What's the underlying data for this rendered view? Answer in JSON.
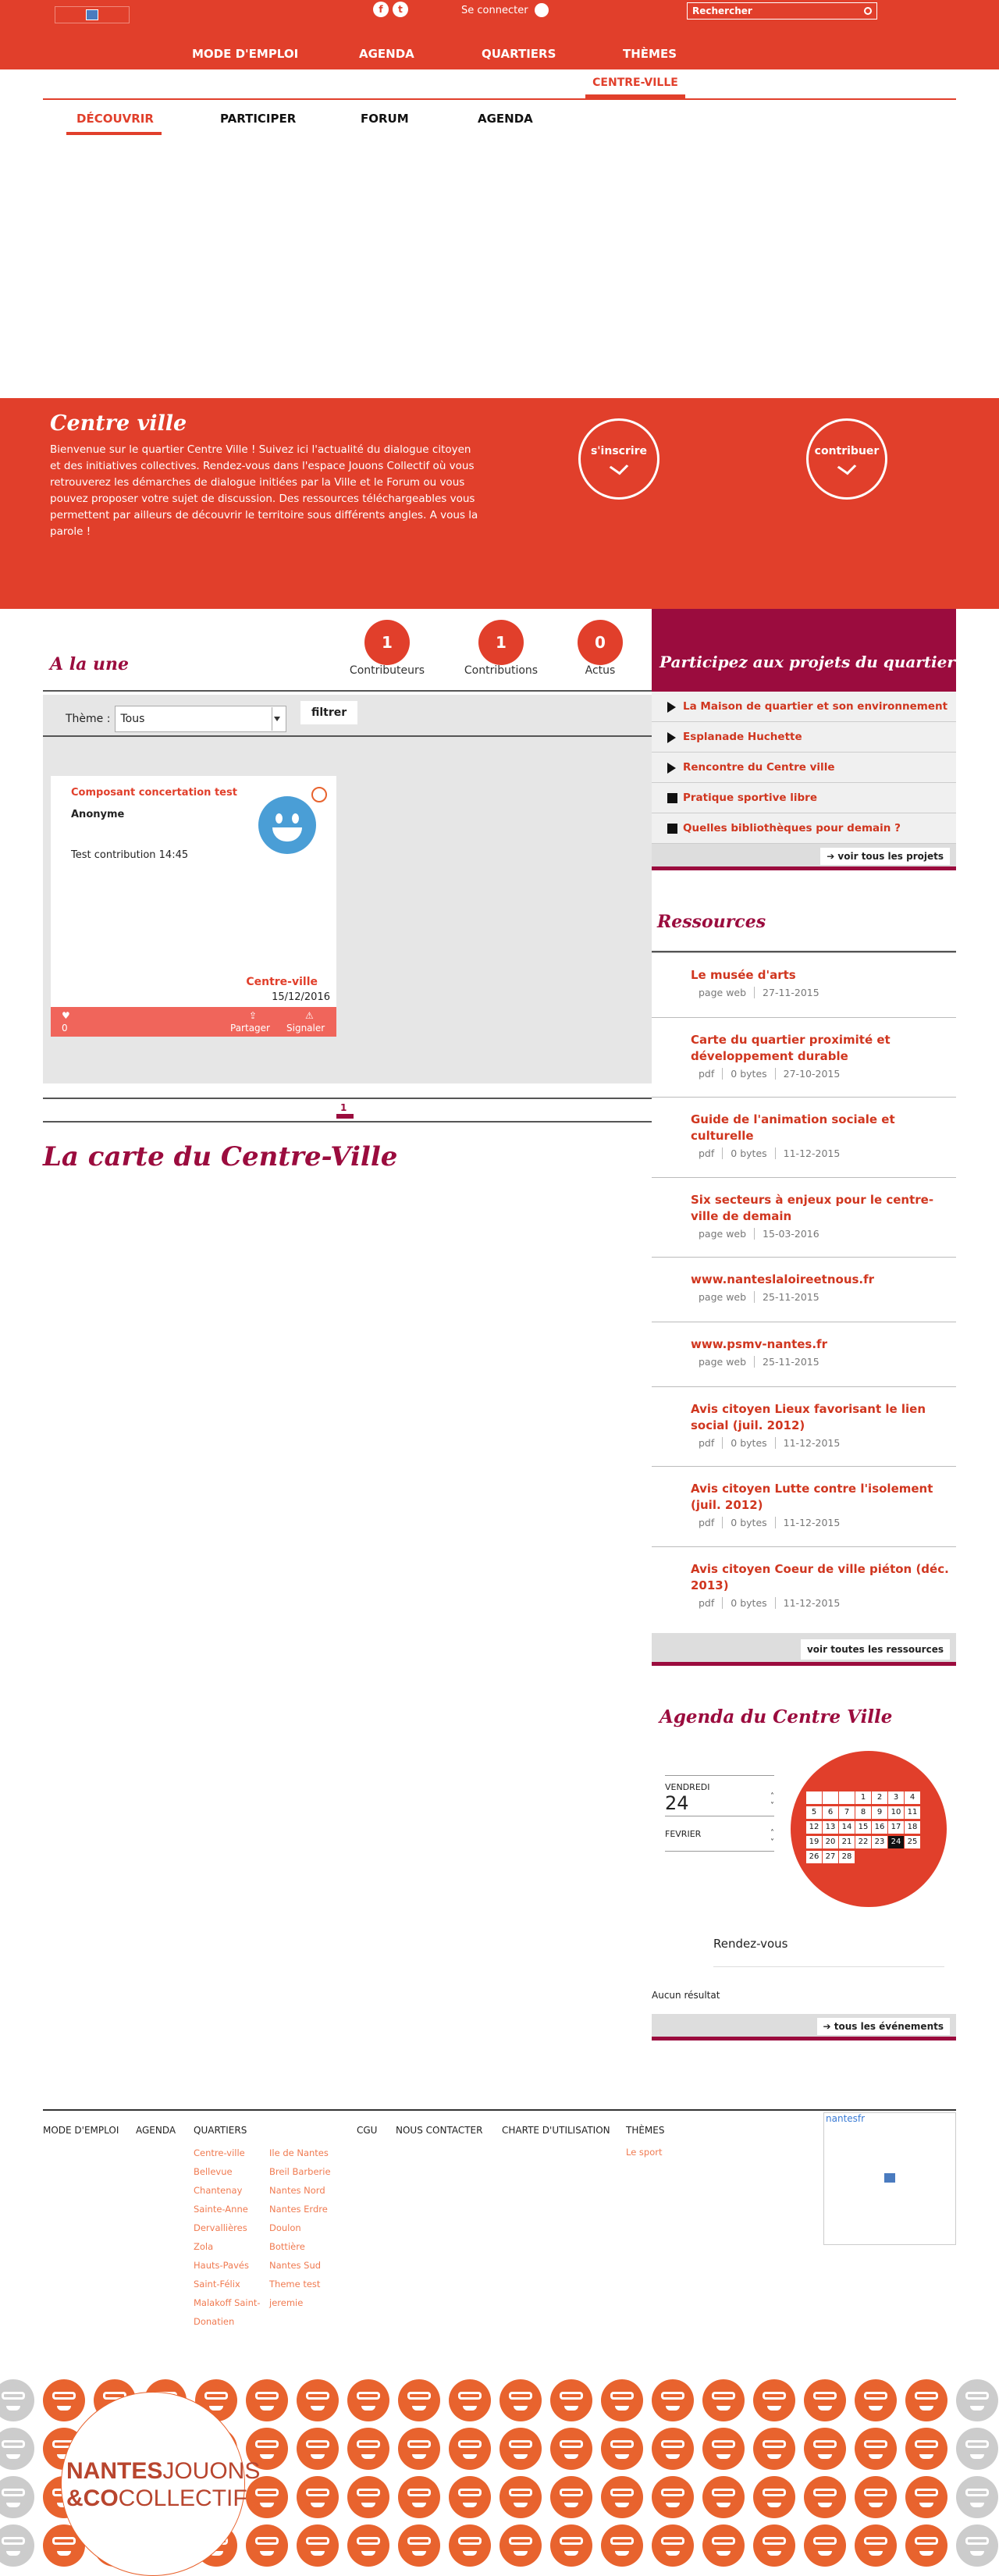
{
  "header": {
    "search_placeholder": "Rechercher",
    "login": "Se connecter",
    "social": [
      "f",
      "t"
    ]
  },
  "mainnav": [
    "MODE D'EMPLOI",
    "AGENDA",
    "QUARTIERS",
    "THÈMES"
  ],
  "active_quartier": "CENTRE-VILLE",
  "subnav": [
    "DÉCOUVRIR",
    "PARTICIPER",
    "FORUM",
    "AGENDA"
  ],
  "hero": {
    "title": "Centre ville",
    "text": "Bienvenue sur le quartier Centre Ville ! Suivez ici l'actualité du dialogue citoyen et des initiatives collectives. Rendez-vous dans l'espace Jouons Collectif où vous retrouverez les démarches de dialogue initiées par la Ville et le Forum ou vous pouvez proposer votre sujet de discussion. Des ressources téléchargeables vous permettent par ailleurs de découvrir le territoire sous différents angles. A vous la parole !",
    "btn_inscrire": "s'inscrire",
    "btn_contribuer": "contribuer"
  },
  "stats": [
    {
      "value": "1",
      "label": "Contributeurs"
    },
    {
      "value": "1",
      "label": "Contributions"
    },
    {
      "value": "0",
      "label": "Actus"
    }
  ],
  "alaune": {
    "title": "A la une",
    "theme_label": "Thème :",
    "theme_value": "Tous",
    "filter_btn": "filtrer"
  },
  "card": {
    "title": "Composant concertation test",
    "author": "Anonyme",
    "text": "Test contribution 14:45",
    "quartier": "Centre-ville",
    "date": "15/12/2016",
    "likes": "0",
    "share": "Partager",
    "report": "Signaler"
  },
  "pager": "1",
  "map_title": "La carte du Centre-Ville",
  "projects": {
    "title": "Participez aux projets du quartier",
    "items": [
      {
        "label": "La Maison de quartier et son environnement",
        "mark": "tri"
      },
      {
        "label": "Esplanade Huchette",
        "mark": "tri"
      },
      {
        "label": "Rencontre du Centre ville",
        "mark": "tri"
      },
      {
        "label": "Pratique sportive libre",
        "mark": "sq"
      },
      {
        "label": "Quelles bibliothèques pour demain ?",
        "mark": "sq"
      }
    ],
    "all": "voir tous les projets"
  },
  "resources": {
    "title": "Ressources",
    "items": [
      {
        "title": "Le musée d'arts",
        "meta": [
          "page web",
          "27-11-2015"
        ]
      },
      {
        "title": "Carte du quartier proximité et développement durable",
        "meta": [
          "pdf",
          "0 bytes",
          "27-10-2015"
        ]
      },
      {
        "title": "Guide de l'animation sociale et culturelle",
        "meta": [
          "pdf",
          "0 bytes",
          "11-12-2015"
        ]
      },
      {
        "title": "Six secteurs à enjeux pour le centre-ville de demain",
        "meta": [
          "page web",
          "15-03-2016"
        ]
      },
      {
        "title": "www.nanteslaloireetnous.fr",
        "meta": [
          "page web",
          "25-11-2015"
        ]
      },
      {
        "title": "www.psmv-nantes.fr",
        "meta": [
          "page web",
          "25-11-2015"
        ]
      },
      {
        "title": "Avis citoyen Lieux favorisant le lien social (juil. 2012)",
        "meta": [
          "pdf",
          "0 bytes",
          "11-12-2015"
        ]
      },
      {
        "title": "Avis citoyen Lutte contre l'isolement (juil. 2012)",
        "meta": [
          "pdf",
          "0 bytes",
          "11-12-2015"
        ]
      },
      {
        "title": "Avis citoyen Coeur de ville piéton (déc. 2013)",
        "meta": [
          "pdf",
          "0 bytes",
          "11-12-2015"
        ]
      }
    ],
    "all": "voir toutes les ressources"
  },
  "agenda": {
    "title": "Agenda du Centre Ville",
    "day_name": "VENDREDI",
    "day": "24",
    "month": "FEVRIER",
    "rdv": "Rendez-vous",
    "none": "Aucun résultat",
    "all": "tous les événements",
    "days": [
      "",
      "",
      "",
      "1",
      "2",
      "3",
      "4",
      "5",
      "6",
      "7",
      "8",
      "9",
      "10",
      "11",
      "12",
      "13",
      "14",
      "15",
      "16",
      "17",
      "18",
      "19",
      "20",
      "21",
      "22",
      "23",
      "24",
      "25",
      "26",
      "27",
      "28"
    ],
    "selected": "24"
  },
  "footer": {
    "col1": "MODE D'EMPLOI",
    "col2": "AGENDA",
    "col3": "QUARTIERS",
    "quartiers_a": [
      "Centre-ville",
      "Bellevue",
      "Chantenay",
      "Sainte-Anne",
      "Dervallières",
      "Zola",
      "Hauts-Pavés",
      "Saint-Félix",
      "Malakoff Saint-Donatien"
    ],
    "quartiers_b": [
      "Ile de Nantes",
      "Breil Barberie",
      "Nantes Nord",
      "Nantes Erdre",
      "Doulon",
      "Bottière",
      "Nantes Sud",
      "Theme test",
      "jeremie"
    ],
    "cgu": "CGU",
    "contact": "NOUS CONTACTER",
    "charte": "CHARTE D'UTILISATION",
    "themes": "THÈMES",
    "themes_items": [
      "Le sport"
    ],
    "twitter": "nantesfr"
  },
  "logo": {
    "line1a": "NANTES",
    "line2a": "&CO",
    "line1b": "JOUONS",
    "line2b": "COLLECTIF"
  },
  "colors": {
    "red": "#e13f2b",
    "bordeaux": "#9b0c3e",
    "orange": "#e8632e"
  }
}
